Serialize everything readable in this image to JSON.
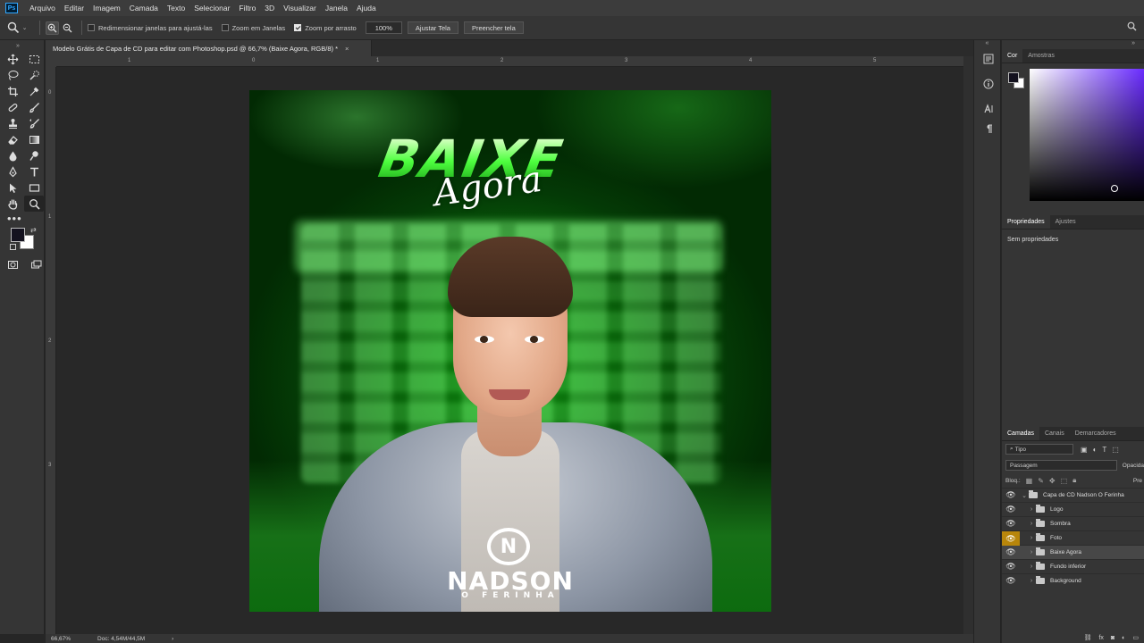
{
  "app": {
    "logo_text": "Ps",
    "menus": [
      "Arquivo",
      "Editar",
      "Imagem",
      "Camada",
      "Texto",
      "Selecionar",
      "Filtro",
      "3D",
      "Visualizar",
      "Janela",
      "Ajuda"
    ]
  },
  "options": {
    "resize_windows_label": "Redimensionar janelas para ajustá-las",
    "zoom_all_windows_label": "Zoom em Janelas",
    "scrubby_zoom_label": "Zoom por arrasto",
    "zoom_value": "100%",
    "fit_screen_label": "Ajustar Tela",
    "fill_screen_label": "Preencher tela",
    "resize_windows_checked": false,
    "zoom_all_windows_checked": false,
    "scrubby_zoom_checked": true
  },
  "document": {
    "tab_title": "Modelo Grátis de Capa de CD para editar com Photoshop.psd @ 66,7% (Baixe Agora, RGB/8) *",
    "close_symbol": "×",
    "ruler_top_labels": [
      "1",
      "0",
      "1",
      "2",
      "3",
      "4",
      "5"
    ],
    "ruler_left_labels": [
      "0",
      "1",
      "2",
      "3"
    ]
  },
  "artwork": {
    "headline": "BAIXE",
    "subheadline": "Agora",
    "logo_letter": "N",
    "artist_name": "NADSON",
    "artist_subtitle": "O FERINHA"
  },
  "status": {
    "zoom": "66,67%",
    "doc_info": "Doc: 4,54M/44,5M",
    "arrow": "›"
  },
  "color_panel": {
    "tabs": [
      "Cor",
      "Amostras"
    ],
    "foreground": "#14121f",
    "background": "#ffffff"
  },
  "properties_panel": {
    "tabs": [
      "Propriedades",
      "Ajustes"
    ],
    "empty_text": "Sem propriedades"
  },
  "layers_panel": {
    "tabs": [
      "Camadas",
      "Canais",
      "Demarcadores"
    ],
    "filter_kind": "Tipo",
    "blend_mode": "Passagem",
    "opacity_label": "Opacida",
    "lock_label": "Bloq.:",
    "fill_label": "Pre",
    "group_name": "Capa de CD Nadson O Ferinha",
    "layers": [
      "Logo",
      "Sombra",
      "Foto",
      "Baixe Agora",
      "Fundo inferior",
      "Background"
    ]
  }
}
